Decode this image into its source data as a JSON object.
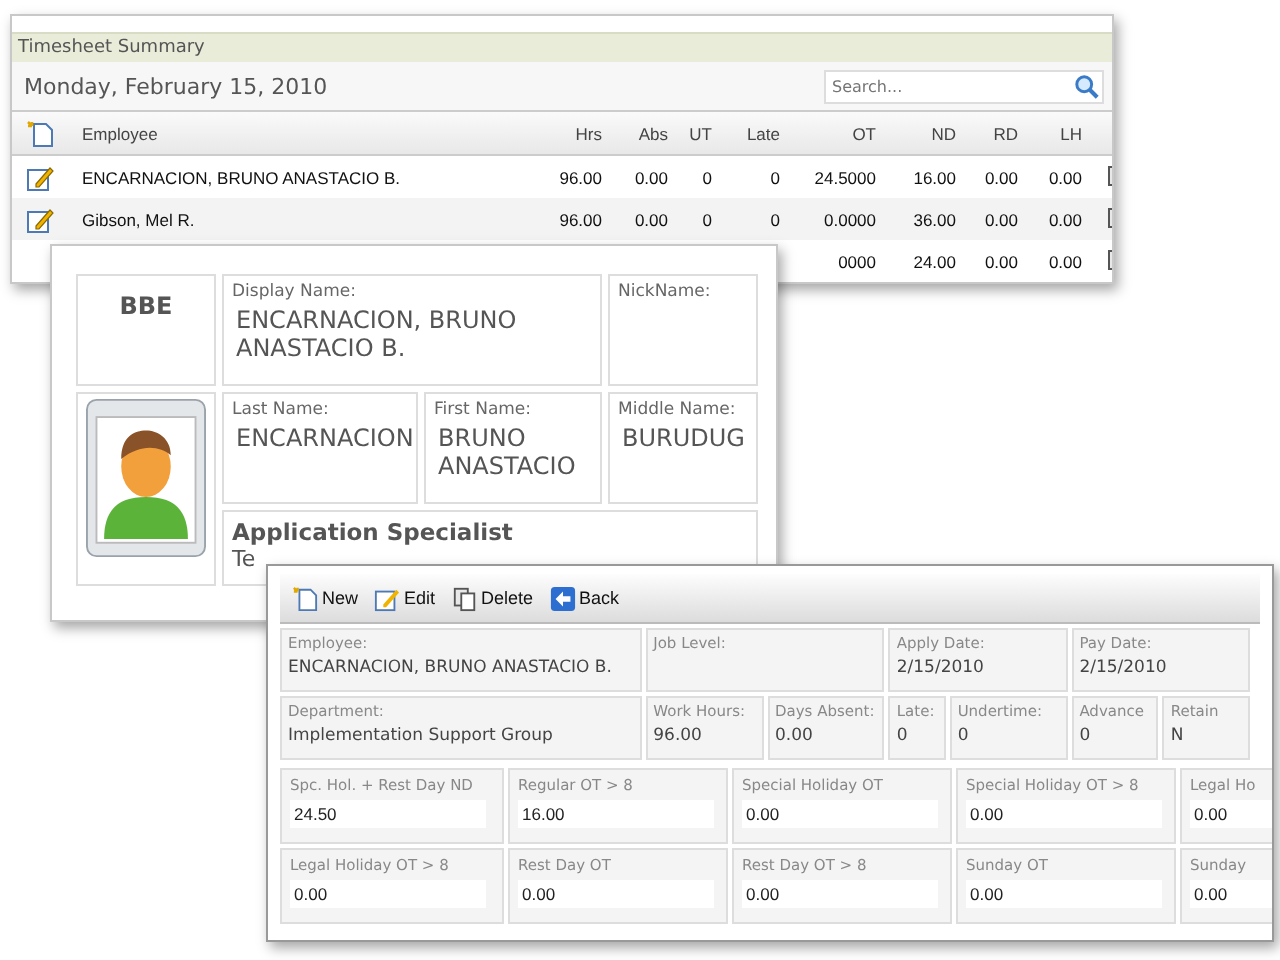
{
  "summary": {
    "title": "Timesheet Summary",
    "date": "Monday, February 15, 2010",
    "search": {
      "placeholder": "Search..."
    },
    "columns": [
      "Employee",
      "Hrs",
      "Abs",
      "UT",
      "Late",
      "OT",
      "ND",
      "RD",
      "LH"
    ],
    "rows": [
      {
        "employee": "ENCARNACION, BRUNO ANASTACIO B.",
        "hrs": "96.00",
        "abs": "0.00",
        "ut": "0",
        "late": "0",
        "ot": "24.5000",
        "nd": "16.00",
        "rd": "0.00",
        "lh": "0.00"
      },
      {
        "employee": "Gibson, Mel R.",
        "hrs": "96.00",
        "abs": "0.00",
        "ut": "0",
        "late": "0",
        "ot": "0.0000",
        "nd": "36.00",
        "rd": "0.00",
        "lh": "0.00"
      },
      {
        "ot": "0000",
        "nd": "24.00",
        "rd": "0.00",
        "lh": "0.00"
      }
    ]
  },
  "profile": {
    "initials": "BBE",
    "display_name": {
      "label": "Display Name:",
      "value": "ENCARNACION, BRUNO ANASTACIO B."
    },
    "nickname": {
      "label": "NickName:"
    },
    "names": [
      {
        "label": "Last Name:",
        "value": "ENCARNACION"
      },
      {
        "label": "First Name:",
        "value": "BRUNO ANASTACIO"
      },
      {
        "label": "Middle Name:",
        "value": "BURUDUG"
      }
    ],
    "position": "Application Specialist",
    "department": "Te"
  },
  "detail": {
    "toolbar": [
      {
        "label": "New",
        "kind": "new"
      },
      {
        "label": "Edit",
        "kind": "edit"
      },
      {
        "label": "Delete",
        "kind": "delete"
      },
      {
        "label": "Back",
        "kind": "back"
      }
    ],
    "info": [
      {
        "label": "Employee:",
        "value": "ENCARNACION, BRUNO ANASTACIO B."
      },
      {
        "label": "Job Level:"
      },
      {
        "label": "Apply Date:",
        "value": "2/15/2010"
      },
      {
        "label": "Pay Date:",
        "value": "2/15/2010"
      },
      {
        "label": "Department:",
        "value": "Implementation Support Group"
      },
      {
        "label": "Work Hours:",
        "value": "96.00"
      },
      {
        "label": "Days Absent:",
        "value": "0.00"
      },
      {
        "label": "Late:",
        "value": "0"
      },
      {
        "label": "Undertime:",
        "value": "0"
      },
      {
        "label": "Advance",
        "value": "0"
      },
      {
        "label": "Retain",
        "value": "N"
      }
    ],
    "fields": [
      {
        "label": "Spc. Hol. + Rest Day ND",
        "value": "24.50"
      },
      {
        "label": "Regular OT > 8",
        "value": "16.00"
      },
      {
        "label": "Special Holiday OT",
        "value": "0.00"
      },
      {
        "label": "Special Holiday OT > 8",
        "value": "0.00"
      },
      {
        "label": "Legal Ho",
        "value": "0.00"
      },
      {
        "label": "Legal Holiday OT > 8",
        "value": "0.00"
      },
      {
        "label": "Rest Day OT",
        "value": "0.00"
      },
      {
        "label": "Rest Day OT > 8",
        "value": "0.00"
      },
      {
        "label": "Sunday OT",
        "value": "0.00"
      },
      {
        "label": "Sunday",
        "value": "0.00"
      }
    ]
  }
}
